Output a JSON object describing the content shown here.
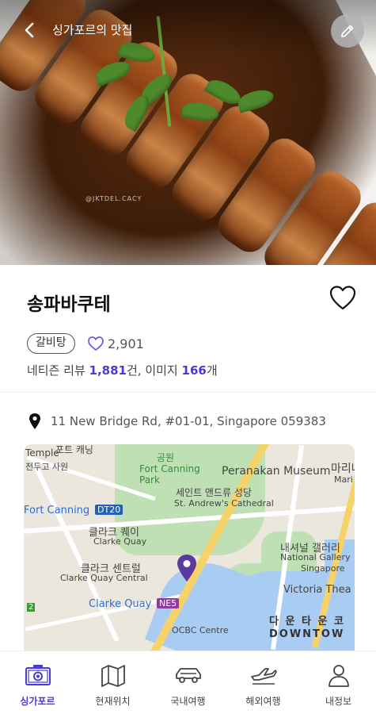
{
  "header": {
    "title": "싱가포르의 맛집",
    "watermark": "@JKTDEL.CACY"
  },
  "restaurant": {
    "name": "송파바쿠테",
    "tag": "갈비탕",
    "likes": "2,901",
    "reviews_prefix": "네티즌 리뷰 ",
    "reviews_count": "1,881",
    "reviews_mid": "건, 이미지 ",
    "images_count": "166",
    "images_suffix": "개",
    "address": "11 New Bridge Rd, #01-01, Singapore 059383"
  },
  "map": {
    "labels": {
      "temple_ko": "포트 캐닝",
      "temple": "Temple",
      "temple_sub": "전두고 사원",
      "park_ko": "공원",
      "fort_canning_park": "Fort Canning",
      "park": "Park",
      "peranakan": "Peranakan Museum",
      "marina_ko": "마리나",
      "marina": "Mari",
      "cathedral_ko": "세인트 앤드류 성당",
      "cathedral": "St. Andrew's Cathedral",
      "fort_canning_station": "Fort Canning",
      "station_dt20": "DT20",
      "clarke_quay_ko": "클라크 퀘이",
      "clarke_quay": "Clarke Quay",
      "clarke_central_ko": "클라크 센트럴",
      "clarke_central": "Clarke Quay Central",
      "gallery_ko": "내셔널 갤러리",
      "gallery": "National Gallery",
      "gallery_sub": "Singapore",
      "victoria": "Victoria Thea",
      "clarke_station": "Clarke Quay",
      "station_ne5": "NE5",
      "ocbc": "OCBC Centre",
      "downtown_ko": "다 운 타 운  코",
      "downtown": "DOWNTOW",
      "num2": "2"
    }
  },
  "nav": [
    {
      "label": "싱가포르",
      "icon": "camera-icon",
      "active": true
    },
    {
      "label": "현재위치",
      "icon": "map-icon",
      "active": false
    },
    {
      "label": "국내여행",
      "icon": "car-icon",
      "active": false
    },
    {
      "label": "해외여행",
      "icon": "airplane-icon",
      "active": false
    },
    {
      "label": "내정보",
      "icon": "person-icon",
      "active": false
    }
  ],
  "colors": {
    "accent": "#4a3ad6",
    "pin": "#5b3a9c",
    "station_blue": "#2561b5",
    "station_purple": "#8e3a9e"
  }
}
